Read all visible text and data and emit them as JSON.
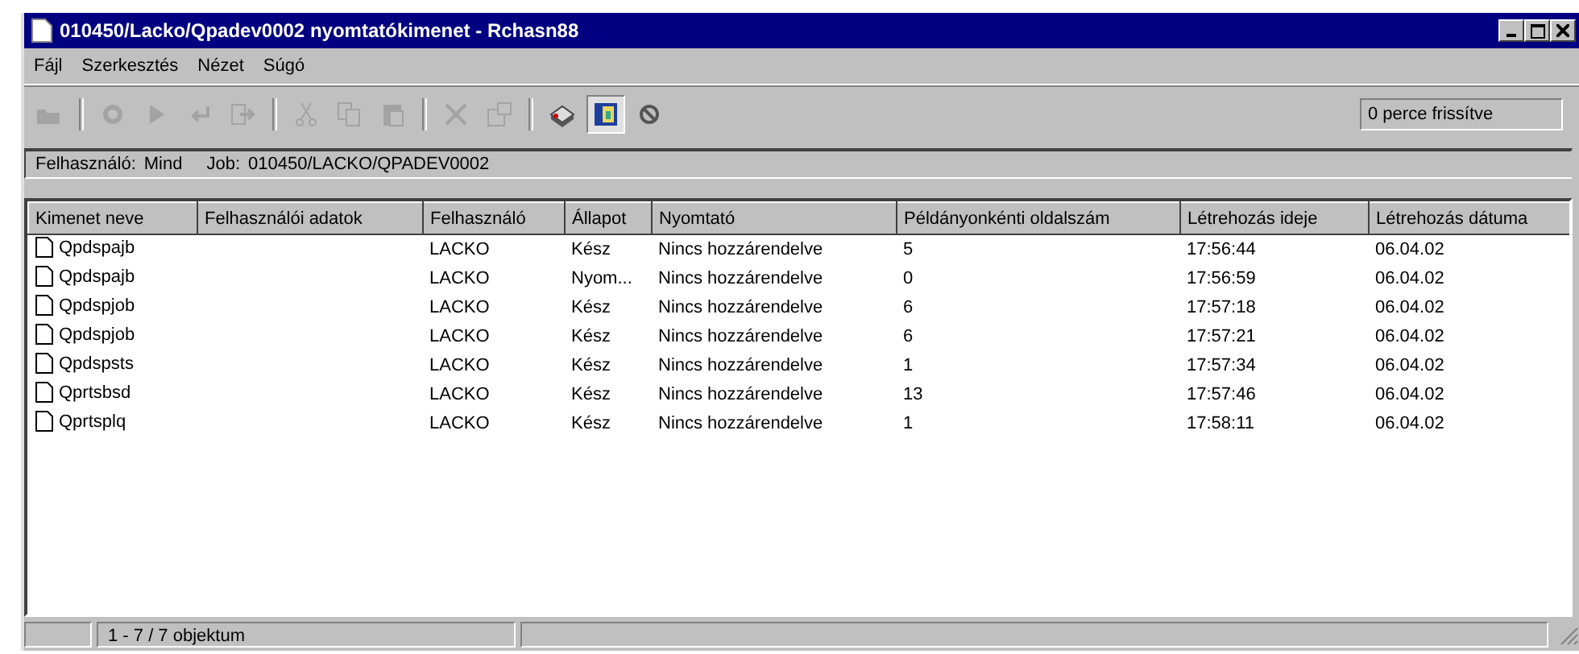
{
  "window": {
    "title": "010450/Lacko/Qpadev0002 nyomtatókimenet - Rchasn88"
  },
  "menu": [
    "Fájl",
    "Szerkesztés",
    "Nézet",
    "Súgó"
  ],
  "toolbar": {
    "buttons": [
      {
        "kind": "open",
        "disabled": true,
        "selected": false
      },
      {
        "kind": "sep"
      },
      {
        "kind": "hold",
        "disabled": true,
        "selected": false
      },
      {
        "kind": "release",
        "disabled": true,
        "selected": false
      },
      {
        "kind": "reply",
        "disabled": true,
        "selected": false
      },
      {
        "kind": "move",
        "disabled": true,
        "selected": false
      },
      {
        "kind": "sep"
      },
      {
        "kind": "cut",
        "disabled": true,
        "selected": false
      },
      {
        "kind": "copy",
        "disabled": true,
        "selected": false
      },
      {
        "kind": "paste",
        "disabled": true,
        "selected": false
      },
      {
        "kind": "sep"
      },
      {
        "kind": "delete",
        "disabled": true,
        "selected": false
      },
      {
        "kind": "properties",
        "disabled": true,
        "selected": false
      },
      {
        "kind": "sep"
      },
      {
        "kind": "printer",
        "disabled": false,
        "selected": false
      },
      {
        "kind": "view",
        "disabled": false,
        "selected": true
      },
      {
        "kind": "stop",
        "disabled": false,
        "selected": false
      }
    ],
    "refresh": "0 perce frissítve"
  },
  "filter": {
    "user_label": "Felhasználó:",
    "user": "Mind",
    "job_label": "Job:",
    "job": "010450/LACKO/QPADEV0002"
  },
  "table": {
    "columns": [
      "Kimenet neve",
      "Felhasználói adatok",
      "Felhasználó",
      "Állapot",
      "Nyomtató",
      "Példányonkénti oldalszám",
      "Létrehozás ideje",
      "Létrehozás dátuma"
    ],
    "rows": [
      [
        "Qpdspajb",
        "",
        "LACKO",
        "Kész",
        "Nincs hozzárendelve",
        "5",
        "17:56:44",
        "06.04.02"
      ],
      [
        "Qpdspajb",
        "",
        "LACKO",
        "Nyom...",
        "Nincs hozzárendelve",
        "0",
        "17:56:59",
        "06.04.02"
      ],
      [
        "Qpdspjob",
        "",
        "LACKO",
        "Kész",
        "Nincs hozzárendelve",
        "6",
        "17:57:18",
        "06.04.02"
      ],
      [
        "Qpdspjob",
        "",
        "LACKO",
        "Kész",
        "Nincs hozzárendelve",
        "6",
        "17:57:21",
        "06.04.02"
      ],
      [
        "Qpdspsts",
        "",
        "LACKO",
        "Kész",
        "Nincs hozzárendelve",
        "1",
        "17:57:34",
        "06.04.02"
      ],
      [
        "Qprtsbsd",
        "",
        "LACKO",
        "Kész",
        "Nincs hozzárendelve",
        "13",
        "17:57:46",
        "06.04.02"
      ],
      [
        "Qprtsplq",
        "",
        "LACKO",
        "Kész",
        "Nincs hozzárendelve",
        "1",
        "17:58:11",
        "06.04.02"
      ]
    ]
  },
  "status_bar": {
    "count": "1 - 7 / 7 objektum"
  }
}
